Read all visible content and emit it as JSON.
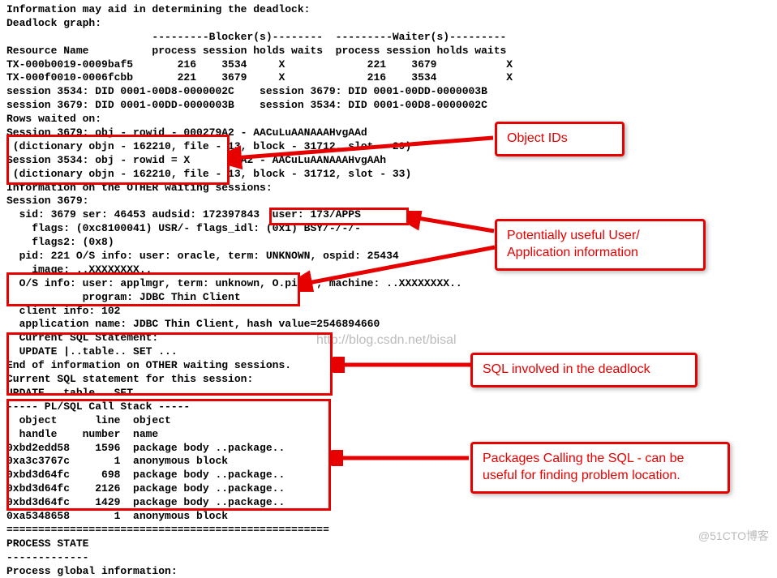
{
  "lines": {
    "l0": "Information may aid in determining the deadlock:",
    "l1": "Deadlock graph:",
    "l2": "                       ---------Blocker(s)--------  ---------Waiter(s)---------",
    "l3": "Resource Name          process session holds waits  process session holds waits",
    "l4": "TX-000b0019-0009baf5       216    3534     X             221    3679           X",
    "l5": "TX-000f0010-0006fcbb       221    3679     X             216    3534           X",
    "l6": "session 3534: DID 0001-00D8-0000002C    session 3679: DID 0001-00DD-0000003B",
    "l7": "session 3679: DID 0001-00DD-0000003B    session 3534: DID 0001-00D8-0000002C",
    "l8": "Rows waited on:",
    "l9": "Session 3679: obj - rowid - 000279A2 - AACuLuAANAAAHvgAAd",
    "l10": " (dictionary objn - 162210, file - 13, block - 31712, slot - 29)",
    "l11": "Session 3534: obj - rowid = X      79A2 - AACuLuAANAAAHvgAAh",
    "l12": " (dictionary objn - 162210, file - 13, block - 31712, slot - 33)",
    "l13": "Information on the OTHER waiting sessions:",
    "l14": "Session 3679:",
    "l15": "  sid: 3679 ser: 46453 audsid: 172397843  user: 173/APPS",
    "l16": "    flags: (0xc8100041) USR/- flags_idl: (0x1) BSY/-/-/-",
    "l17": "    flags2: (0x8)",
    "l18": "  pid: 221 O/S info: user: oracle, term: UNKNOWN, ospid: 25434",
    "l19": "    image: ..XXXXXXXX..",
    "l20": "  O/S info: user: applmgr, term: unknown, O.pid: , machine: ..XXXXXXXX..",
    "l21": "            program: JDBC Thin Client",
    "l22": "  client info: 102",
    "l23": "  application name: JDBC Thin Client, hash value=2546894660",
    "l24": "  Current SQL Statement:",
    "l25": "  UPDATE |..table.. SET ...",
    "l26": "End of information on OTHER waiting sessions.",
    "l27": "Current SQL statement for this session:",
    "l28": "UPDATE ..table.. SET ...",
    "l29": "----- PL/SQL Call Stack -----",
    "l30": "  object      line  object",
    "l31": "  handle    number  name",
    "l32": "0xbd2edd58    1596  package body ..package..",
    "l33": "0xa3c3767c       1  anonymous block",
    "l34": "0xbd3d64fc     698  package body ..package..",
    "l35": "0xbd3d64fc    2126  package body ..package..",
    "l36": "0xbd3d64fc    1429  package body ..package..",
    "l37": "0xa5348658       1  anonymous block",
    "l38": "===================================================",
    "l39": "PROCESS STATE",
    "l40": "-------------",
    "l41": "Process global information:"
  },
  "callouts": {
    "c1": "Object IDs",
    "c2": "Potentially useful User/ Application information",
    "c3": "SQL involved in the deadlock",
    "c4": "Packages Calling the SQL - can be useful for finding problem location."
  },
  "watermarks": {
    "w1": "http://blog.csdn.net/bisal",
    "w2": "@51CTO博客"
  }
}
